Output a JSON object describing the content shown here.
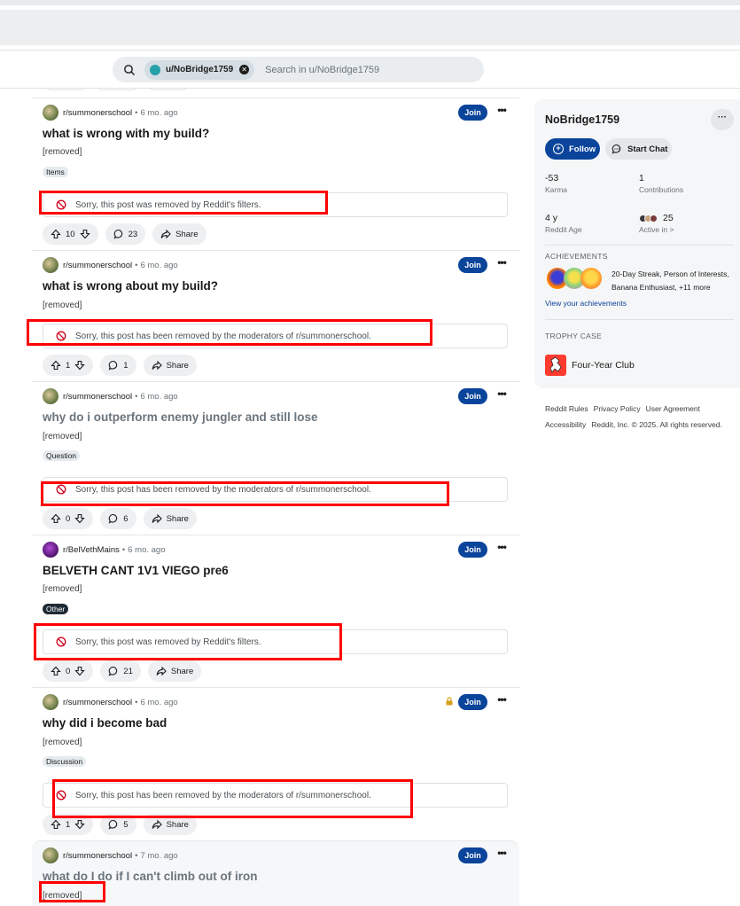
{
  "search": {
    "chip_label": "u/NoBridge1759",
    "placeholder": "Search in u/NoBridge1759"
  },
  "posts": [
    {
      "subreddit": "r/summonerschool",
      "age": "6 mo. ago",
      "join_label": "Join",
      "title": "what is wrong with my build?",
      "body": "[removed]",
      "flair": "Items",
      "removed_notice": "Sorry, this post was removed by Reddit's filters.",
      "score": "10",
      "comments": "23",
      "share_label": "Share"
    },
    {
      "subreddit": "r/summonerschool",
      "age": "6 mo. ago",
      "join_label": "Join",
      "title": "what is wrong about my build?",
      "body": "[removed]",
      "removed_notice": "Sorry, this post has been removed by the moderators of r/summonerschool.",
      "score": "1",
      "comments": "1",
      "share_label": "Share"
    },
    {
      "subreddit": "r/summonerschool",
      "age": "6 mo. ago",
      "join_label": "Join",
      "title": "why do i outperform enemy jungler and still lose",
      "body": "[removed]",
      "flair": "Question",
      "removed_notice": "Sorry, this post has been removed by the moderators of r/summonerschool.",
      "score": "0",
      "comments": "6",
      "share_label": "Share"
    },
    {
      "subreddit": "r/BelVethMains",
      "age": "6 mo. ago",
      "join_label": "Join",
      "title": "BELVETH CANT 1V1 VIEGO pre6",
      "body": "[removed]",
      "flair": "Other",
      "removed_notice": "Sorry, this post was removed by Reddit's filters.",
      "score": "0",
      "comments": "21",
      "share_label": "Share"
    },
    {
      "subreddit": "r/summonerschool",
      "age": "6 mo. ago",
      "join_label": "Join",
      "title": "why did i become bad",
      "body": "[removed]",
      "flair": "Discussion",
      "removed_notice": "Sorry, this post has been removed by the moderators of r/summonerschool.",
      "score": "1",
      "comments": "5",
      "share_label": "Share"
    },
    {
      "subreddit": "r/summonerschool",
      "age": "7 mo. ago",
      "join_label": "Join",
      "title": "what do I do if I can't climb out of iron",
      "body": "[removed]"
    }
  ],
  "sidebar": {
    "username": "NoBridge1759",
    "more_label": "···",
    "follow_label": "Follow",
    "chat_label": "Start Chat",
    "karma_value": "-53",
    "karma_label": "Karma",
    "contributions_value": "1",
    "contributions_label": "Contributions",
    "age_value": "4 y",
    "age_label": "Reddit Age",
    "active_in_value": "25",
    "active_in_label": "Active in >",
    "achievements_heading": "ACHIEVEMENTS",
    "achievements_text": "20-Day Streak, Person of Interests, Banana Enthusiast, +11 more",
    "achievements_link": "View your achievements",
    "trophy_heading": "TROPHY CASE",
    "trophy_name": "Four-Year Club"
  },
  "footer": {
    "links": [
      "Reddit Rules",
      "Privacy Policy",
      "User Agreement",
      "Accessibility"
    ],
    "copyright": "Reddit, Inc. © 2025. All rights reserved."
  },
  "colors": {
    "join": "#0a449b",
    "highlight_frame": "#ff0000",
    "pill_bg": "#edeff1"
  }
}
